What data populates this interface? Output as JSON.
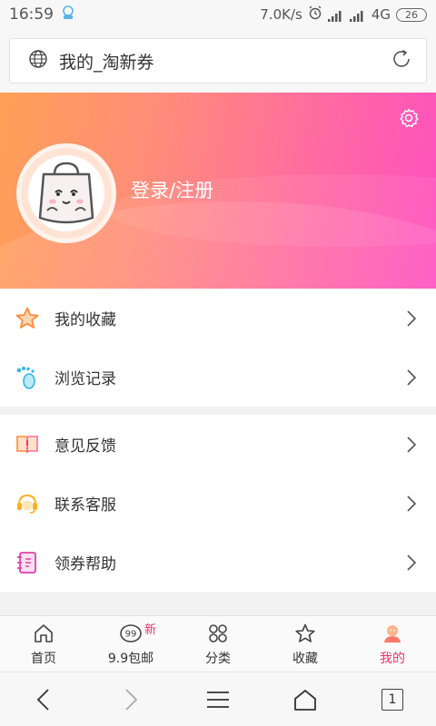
{
  "status_bar": {
    "time": "16:59",
    "net_speed": "7.0K/s",
    "network": "4G",
    "battery": "26"
  },
  "address_bar": {
    "title": "我的_淘新券"
  },
  "profile": {
    "login_label": "登录/注册"
  },
  "menu_group_1": [
    {
      "label": "我的收藏",
      "icon": "star-icon"
    },
    {
      "label": "浏览记录",
      "icon": "footprint-icon"
    }
  ],
  "menu_group_2": [
    {
      "label": "意见反馈",
      "icon": "feedback-icon"
    },
    {
      "label": "联系客服",
      "icon": "headset-icon"
    },
    {
      "label": "领券帮助",
      "icon": "help-book-icon"
    }
  ],
  "tab_bar": {
    "tabs": [
      {
        "label": "首页",
        "icon": "home-icon"
      },
      {
        "label": "9.9包邮",
        "icon": "nine-nine-icon",
        "badge": "新"
      },
      {
        "label": "分类",
        "icon": "category-icon"
      },
      {
        "label": "收藏",
        "icon": "star-outline-icon"
      },
      {
        "label": "我的",
        "icon": "profile-icon",
        "active": true
      }
    ]
  },
  "browser_nav": {
    "tab_count": "1"
  },
  "colors": {
    "accent": "#f5306d",
    "banner_start": "#ffa056",
    "banner_end": "#ff4fc0"
  }
}
